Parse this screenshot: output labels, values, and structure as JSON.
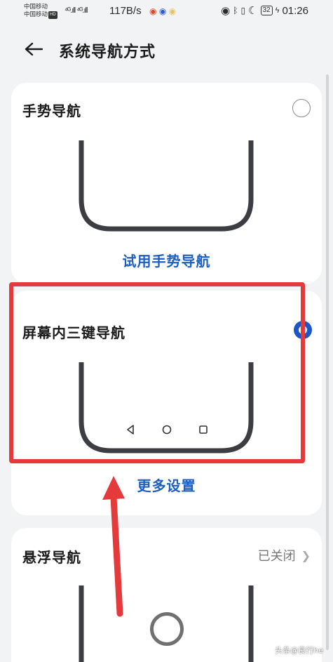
{
  "status_bar": {
    "carrier_1": "中国移动",
    "carrier_2": "中国移动",
    "hd_badge": "HD",
    "signals": "⁴ᴳ.ıll ⁴ᴳ.ıll",
    "net_speed": "117B/s",
    "battery": "32",
    "time": "01:26"
  },
  "header": {
    "title": "系统导航方式"
  },
  "options": {
    "gesture": {
      "title": "手势导航",
      "link": "试用手势导航",
      "selected": false
    },
    "three_key": {
      "title": "屏幕内三键导航",
      "link": "更多设置",
      "selected": true
    },
    "floating": {
      "title": "悬浮导航",
      "status": "已关闭"
    }
  },
  "watermark": "头条@良行he",
  "colors": {
    "accent": "#1d5fc0",
    "radio_selected": "#1a56c9",
    "annotation": "#e43a3c",
    "background": "#f1f3f5"
  },
  "icons": [
    "back-arrow-icon",
    "radio-icon",
    "chevron-right-icon",
    "triangle-back-icon",
    "circle-home-icon",
    "square-recents-icon"
  ]
}
